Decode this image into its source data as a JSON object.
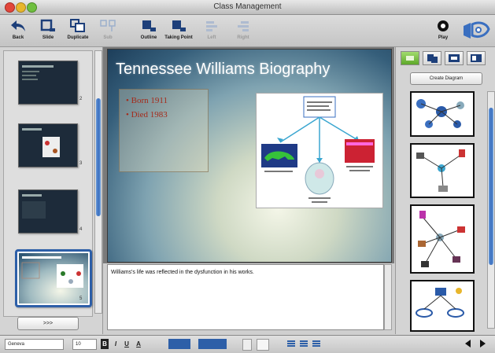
{
  "window": {
    "title": "Class Management"
  },
  "toolbar": {
    "back": "Back",
    "slide": "Slide",
    "duplicate": "Duplicate",
    "sub": "Sub",
    "outline": "Outline",
    "taking_point": "Taking Point",
    "left": "Left",
    "right": "Right",
    "play": "Play"
  },
  "slides": {
    "numbers": [
      "2",
      "3",
      "4",
      "5"
    ],
    "more_label": ">>>"
  },
  "slide": {
    "title": "Tennessee Williams Biography",
    "bullets": [
      "Born 1911",
      "Died 1983"
    ]
  },
  "notes": {
    "text": "Williams's life was reflected in the dysfunction in his works."
  },
  "right_panel": {
    "create_label": "Create Diagram"
  },
  "statusbar": {
    "font": "Geneva",
    "size": "10",
    "bold": "B",
    "italic": "I",
    "underline": "U",
    "color": "A"
  },
  "colors": {
    "accent": "#2d5fa8",
    "bullet": "#a52a1a",
    "active_tab": "#5da72a"
  }
}
